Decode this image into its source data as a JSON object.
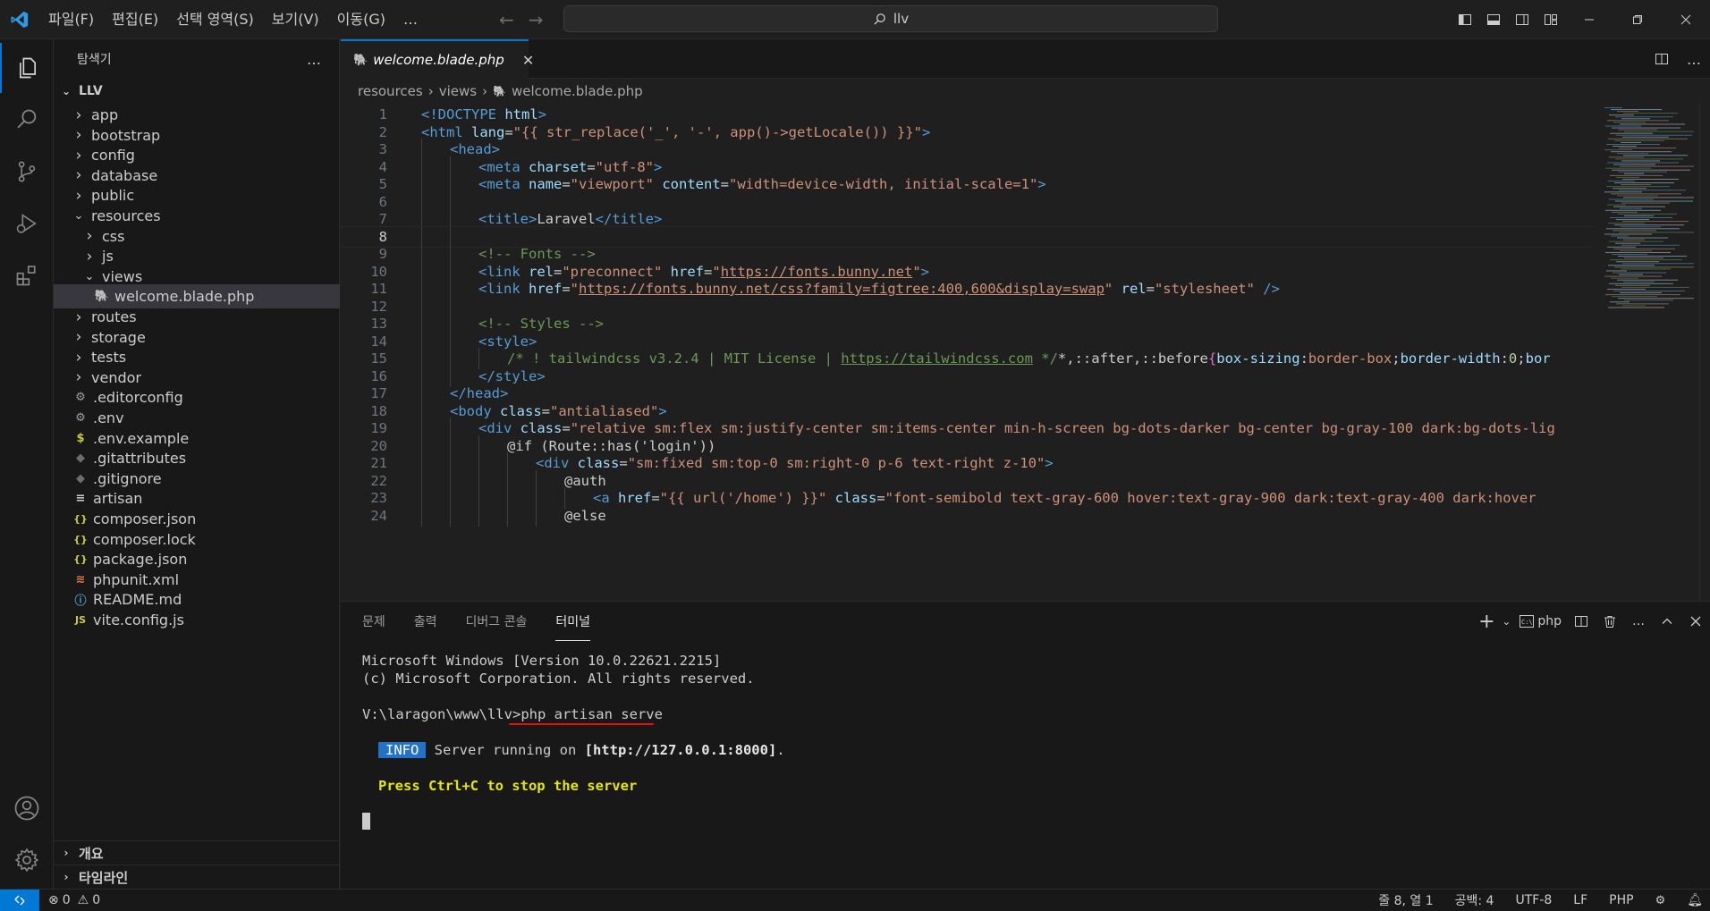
{
  "titlebar": {
    "menu": [
      "파일(F)",
      "편집(E)",
      "선택 영역(S)",
      "보기(V)",
      "이동(G)",
      "…"
    ],
    "search_text": "llv"
  },
  "sidebar": {
    "title": "탐색기",
    "more": "…",
    "root": "LLV",
    "items": [
      {
        "label": "app",
        "kind": "folder",
        "depth": 1,
        "open": false
      },
      {
        "label": "bootstrap",
        "kind": "folder",
        "depth": 1,
        "open": false
      },
      {
        "label": "config",
        "kind": "folder",
        "depth": 1,
        "open": false
      },
      {
        "label": "database",
        "kind": "folder",
        "depth": 1,
        "open": false
      },
      {
        "label": "public",
        "kind": "folder",
        "depth": 1,
        "open": false
      },
      {
        "label": "resources",
        "kind": "folder",
        "depth": 1,
        "open": true
      },
      {
        "label": "css",
        "kind": "folder",
        "depth": 2,
        "open": false
      },
      {
        "label": "js",
        "kind": "folder",
        "depth": 2,
        "open": false
      },
      {
        "label": "views",
        "kind": "folder",
        "depth": 2,
        "open": true
      },
      {
        "label": "welcome.blade.php",
        "kind": "php",
        "depth": 3,
        "selected": true
      },
      {
        "label": "routes",
        "kind": "folder",
        "depth": 1,
        "open": false
      },
      {
        "label": "storage",
        "kind": "folder",
        "depth": 1,
        "open": false
      },
      {
        "label": "tests",
        "kind": "folder",
        "depth": 1,
        "open": false
      },
      {
        "label": "vendor",
        "kind": "folder",
        "depth": 1,
        "open": false
      },
      {
        "label": ".editorconfig",
        "kind": "gear",
        "depth": 1
      },
      {
        "label": ".env",
        "kind": "gear",
        "depth": 1
      },
      {
        "label": ".env.example",
        "kind": "dollar",
        "depth": 1
      },
      {
        "label": ".gitattributes",
        "kind": "git",
        "depth": 1
      },
      {
        "label": ".gitignore",
        "kind": "git",
        "depth": 1
      },
      {
        "label": "artisan",
        "kind": "lines",
        "depth": 1
      },
      {
        "label": "composer.json",
        "kind": "json",
        "depth": 1
      },
      {
        "label": "composer.lock",
        "kind": "json",
        "depth": 1
      },
      {
        "label": "package.json",
        "kind": "json",
        "depth": 1
      },
      {
        "label": "phpunit.xml",
        "kind": "rss",
        "depth": 1
      },
      {
        "label": "README.md",
        "kind": "info",
        "depth": 1
      },
      {
        "label": "vite.config.js",
        "kind": "js",
        "depth": 1
      }
    ],
    "outline": "개요",
    "timeline": "타임라인"
  },
  "editor": {
    "tab_label": "welcome.blade.php",
    "breadcrumb": [
      "resources",
      "views",
      "welcome.blade.php"
    ],
    "current_line": 8,
    "lines": [
      {
        "n": 1,
        "indent": 0,
        "tokens": [
          [
            "tag",
            "<!DOCTYPE "
          ],
          [
            "an",
            "html"
          ],
          [
            "tag",
            ">"
          ]
        ]
      },
      {
        "n": 2,
        "indent": 0,
        "tokens": [
          [
            "tag",
            "<html "
          ],
          [
            "an",
            "lang"
          ],
          [
            "tx",
            "="
          ],
          [
            "av",
            "\"{{ str_replace('_', '-', app()->getLocale()) }}\""
          ],
          [
            "tag",
            ">"
          ]
        ]
      },
      {
        "n": 3,
        "indent": 1,
        "tokens": [
          [
            "tag",
            "<head>"
          ]
        ]
      },
      {
        "n": 4,
        "indent": 2,
        "tokens": [
          [
            "tag",
            "<meta "
          ],
          [
            "an",
            "charset"
          ],
          [
            "tx",
            "="
          ],
          [
            "av",
            "\"utf-8\""
          ],
          [
            "tag",
            ">"
          ]
        ]
      },
      {
        "n": 5,
        "indent": 2,
        "tokens": [
          [
            "tag",
            "<meta "
          ],
          [
            "an",
            "name"
          ],
          [
            "tx",
            "="
          ],
          [
            "av",
            "\"viewport\""
          ],
          [
            "tx",
            " "
          ],
          [
            "an",
            "content"
          ],
          [
            "tx",
            "="
          ],
          [
            "av",
            "\"width=device-width, initial-scale=1\""
          ],
          [
            "tag",
            ">"
          ]
        ]
      },
      {
        "n": 6,
        "indent": 2,
        "tokens": []
      },
      {
        "n": 7,
        "indent": 2,
        "tokens": [
          [
            "tag",
            "<title>"
          ],
          [
            "tx",
            "Laravel"
          ],
          [
            "tag",
            "</title>"
          ]
        ]
      },
      {
        "n": 8,
        "indent": 2,
        "tokens": []
      },
      {
        "n": 9,
        "indent": 2,
        "tokens": [
          [
            "cm",
            "<!-- Fonts -->"
          ]
        ]
      },
      {
        "n": 10,
        "indent": 2,
        "tokens": [
          [
            "tag",
            "<link "
          ],
          [
            "an",
            "rel"
          ],
          [
            "tx",
            "="
          ],
          [
            "av",
            "\"preconnect\""
          ],
          [
            "tx",
            " "
          ],
          [
            "an",
            "href"
          ],
          [
            "tx",
            "="
          ],
          [
            "av",
            "\""
          ],
          [
            "avl",
            "https://fonts.bunny.net"
          ],
          [
            "av",
            "\""
          ],
          [
            "tag",
            ">"
          ]
        ]
      },
      {
        "n": 11,
        "indent": 2,
        "tokens": [
          [
            "tag",
            "<link "
          ],
          [
            "an",
            "href"
          ],
          [
            "tx",
            "="
          ],
          [
            "av",
            "\""
          ],
          [
            "avl",
            "https://fonts.bunny.net/css?family=figtree:400,600&display=swap"
          ],
          [
            "av",
            "\""
          ],
          [
            "tx",
            " "
          ],
          [
            "an",
            "rel"
          ],
          [
            "tx",
            "="
          ],
          [
            "av",
            "\"stylesheet\""
          ],
          [
            "tx",
            " "
          ],
          [
            "tag",
            "/>"
          ]
        ]
      },
      {
        "n": 12,
        "indent": 2,
        "tokens": []
      },
      {
        "n": 13,
        "indent": 2,
        "tokens": [
          [
            "cm",
            "<!-- Styles -->"
          ]
        ]
      },
      {
        "n": 14,
        "indent": 2,
        "tokens": [
          [
            "tag",
            "<style>"
          ]
        ]
      },
      {
        "n": 15,
        "indent": 3,
        "tokens": [
          [
            "cm",
            "/* ! tailwindcss v3.2.4 | MIT License | "
          ],
          [
            "cml",
            "https://tailwindcss.com"
          ],
          [
            "cm",
            " */"
          ],
          [
            "tx",
            "*,::after,::before"
          ],
          [
            "br",
            "{"
          ],
          [
            "an",
            "box-sizing"
          ],
          [
            "tx",
            ":"
          ],
          [
            "av",
            "border-box"
          ],
          [
            "tx",
            ";"
          ],
          [
            "an",
            "border-width"
          ],
          [
            "tx",
            ":"
          ],
          [
            "num",
            "0"
          ],
          [
            "tx",
            ";"
          ],
          [
            "an",
            "bor"
          ]
        ]
      },
      {
        "n": 16,
        "indent": 2,
        "tokens": [
          [
            "tag",
            "</style>"
          ]
        ]
      },
      {
        "n": 17,
        "indent": 1,
        "tokens": [
          [
            "tag",
            "</head>"
          ]
        ]
      },
      {
        "n": 18,
        "indent": 1,
        "tokens": [
          [
            "tag",
            "<body "
          ],
          [
            "an",
            "class"
          ],
          [
            "tx",
            "="
          ],
          [
            "av",
            "\"antialiased\""
          ],
          [
            "tag",
            ">"
          ]
        ]
      },
      {
        "n": 19,
        "indent": 2,
        "tokens": [
          [
            "tag",
            "<div "
          ],
          [
            "an",
            "class"
          ],
          [
            "tx",
            "="
          ],
          [
            "av",
            "\"relative sm:flex sm:justify-center sm:items-center min-h-screen bg-dots-darker bg-center bg-gray-100 dark:bg-dots-lig"
          ]
        ]
      },
      {
        "n": 20,
        "indent": 3,
        "tokens": [
          [
            "tx",
            "@if (Route::has('login'))"
          ]
        ]
      },
      {
        "n": 21,
        "indent": 4,
        "tokens": [
          [
            "tag",
            "<div "
          ],
          [
            "an",
            "class"
          ],
          [
            "tx",
            "="
          ],
          [
            "av",
            "\"sm:fixed sm:top-0 sm:right-0 p-6 text-right z-10\""
          ],
          [
            "tag",
            ">"
          ]
        ]
      },
      {
        "n": 22,
        "indent": 5,
        "tokens": [
          [
            "tx",
            "@auth"
          ]
        ]
      },
      {
        "n": 23,
        "indent": 6,
        "tokens": [
          [
            "tag",
            "<a "
          ],
          [
            "an",
            "href"
          ],
          [
            "tx",
            "="
          ],
          [
            "av",
            "\"{{ url('/home') }}\""
          ],
          [
            "tx",
            " "
          ],
          [
            "an",
            "class"
          ],
          [
            "tx",
            "="
          ],
          [
            "av",
            "\"font-semibold text-gray-600 hover:text-gray-900 dark:text-gray-400 dark:hover"
          ]
        ]
      },
      {
        "n": 24,
        "indent": 5,
        "tokens": [
          [
            "tx",
            "@else"
          ]
        ]
      }
    ]
  },
  "panel": {
    "tabs": [
      "문제",
      "출력",
      "디버그 콘솔",
      "터미널"
    ],
    "active_tab": "터미널",
    "shell": "php",
    "terminal": {
      "line1": "Microsoft Windows [Version 10.0.22621.2215]",
      "line2": "(c) Microsoft Corporation. All rights reserved.",
      "prompt": "V:\\laragon\\www\\llv>",
      "command": "php artisan serve",
      "info_badge": "INFO",
      "info_text": " Server running on ",
      "info_url": "[http://127.0.0.1:8000]",
      "info_end": ".",
      "stop_hint": "Press Ctrl+C to stop the server"
    }
  },
  "statusbar": {
    "errors": "0",
    "warnings": "0",
    "position": "줄 8, 열 1",
    "spaces": "공백: 4",
    "encoding": "UTF-8",
    "eol": "LF",
    "language": "PHP"
  },
  "colors": {
    "accent": "#0078d4",
    "php_icon": "#a074c4",
    "info_badge_bg": "#2472c8",
    "stop_hint": "#e5e510",
    "annotation_underline": "#e51400"
  }
}
